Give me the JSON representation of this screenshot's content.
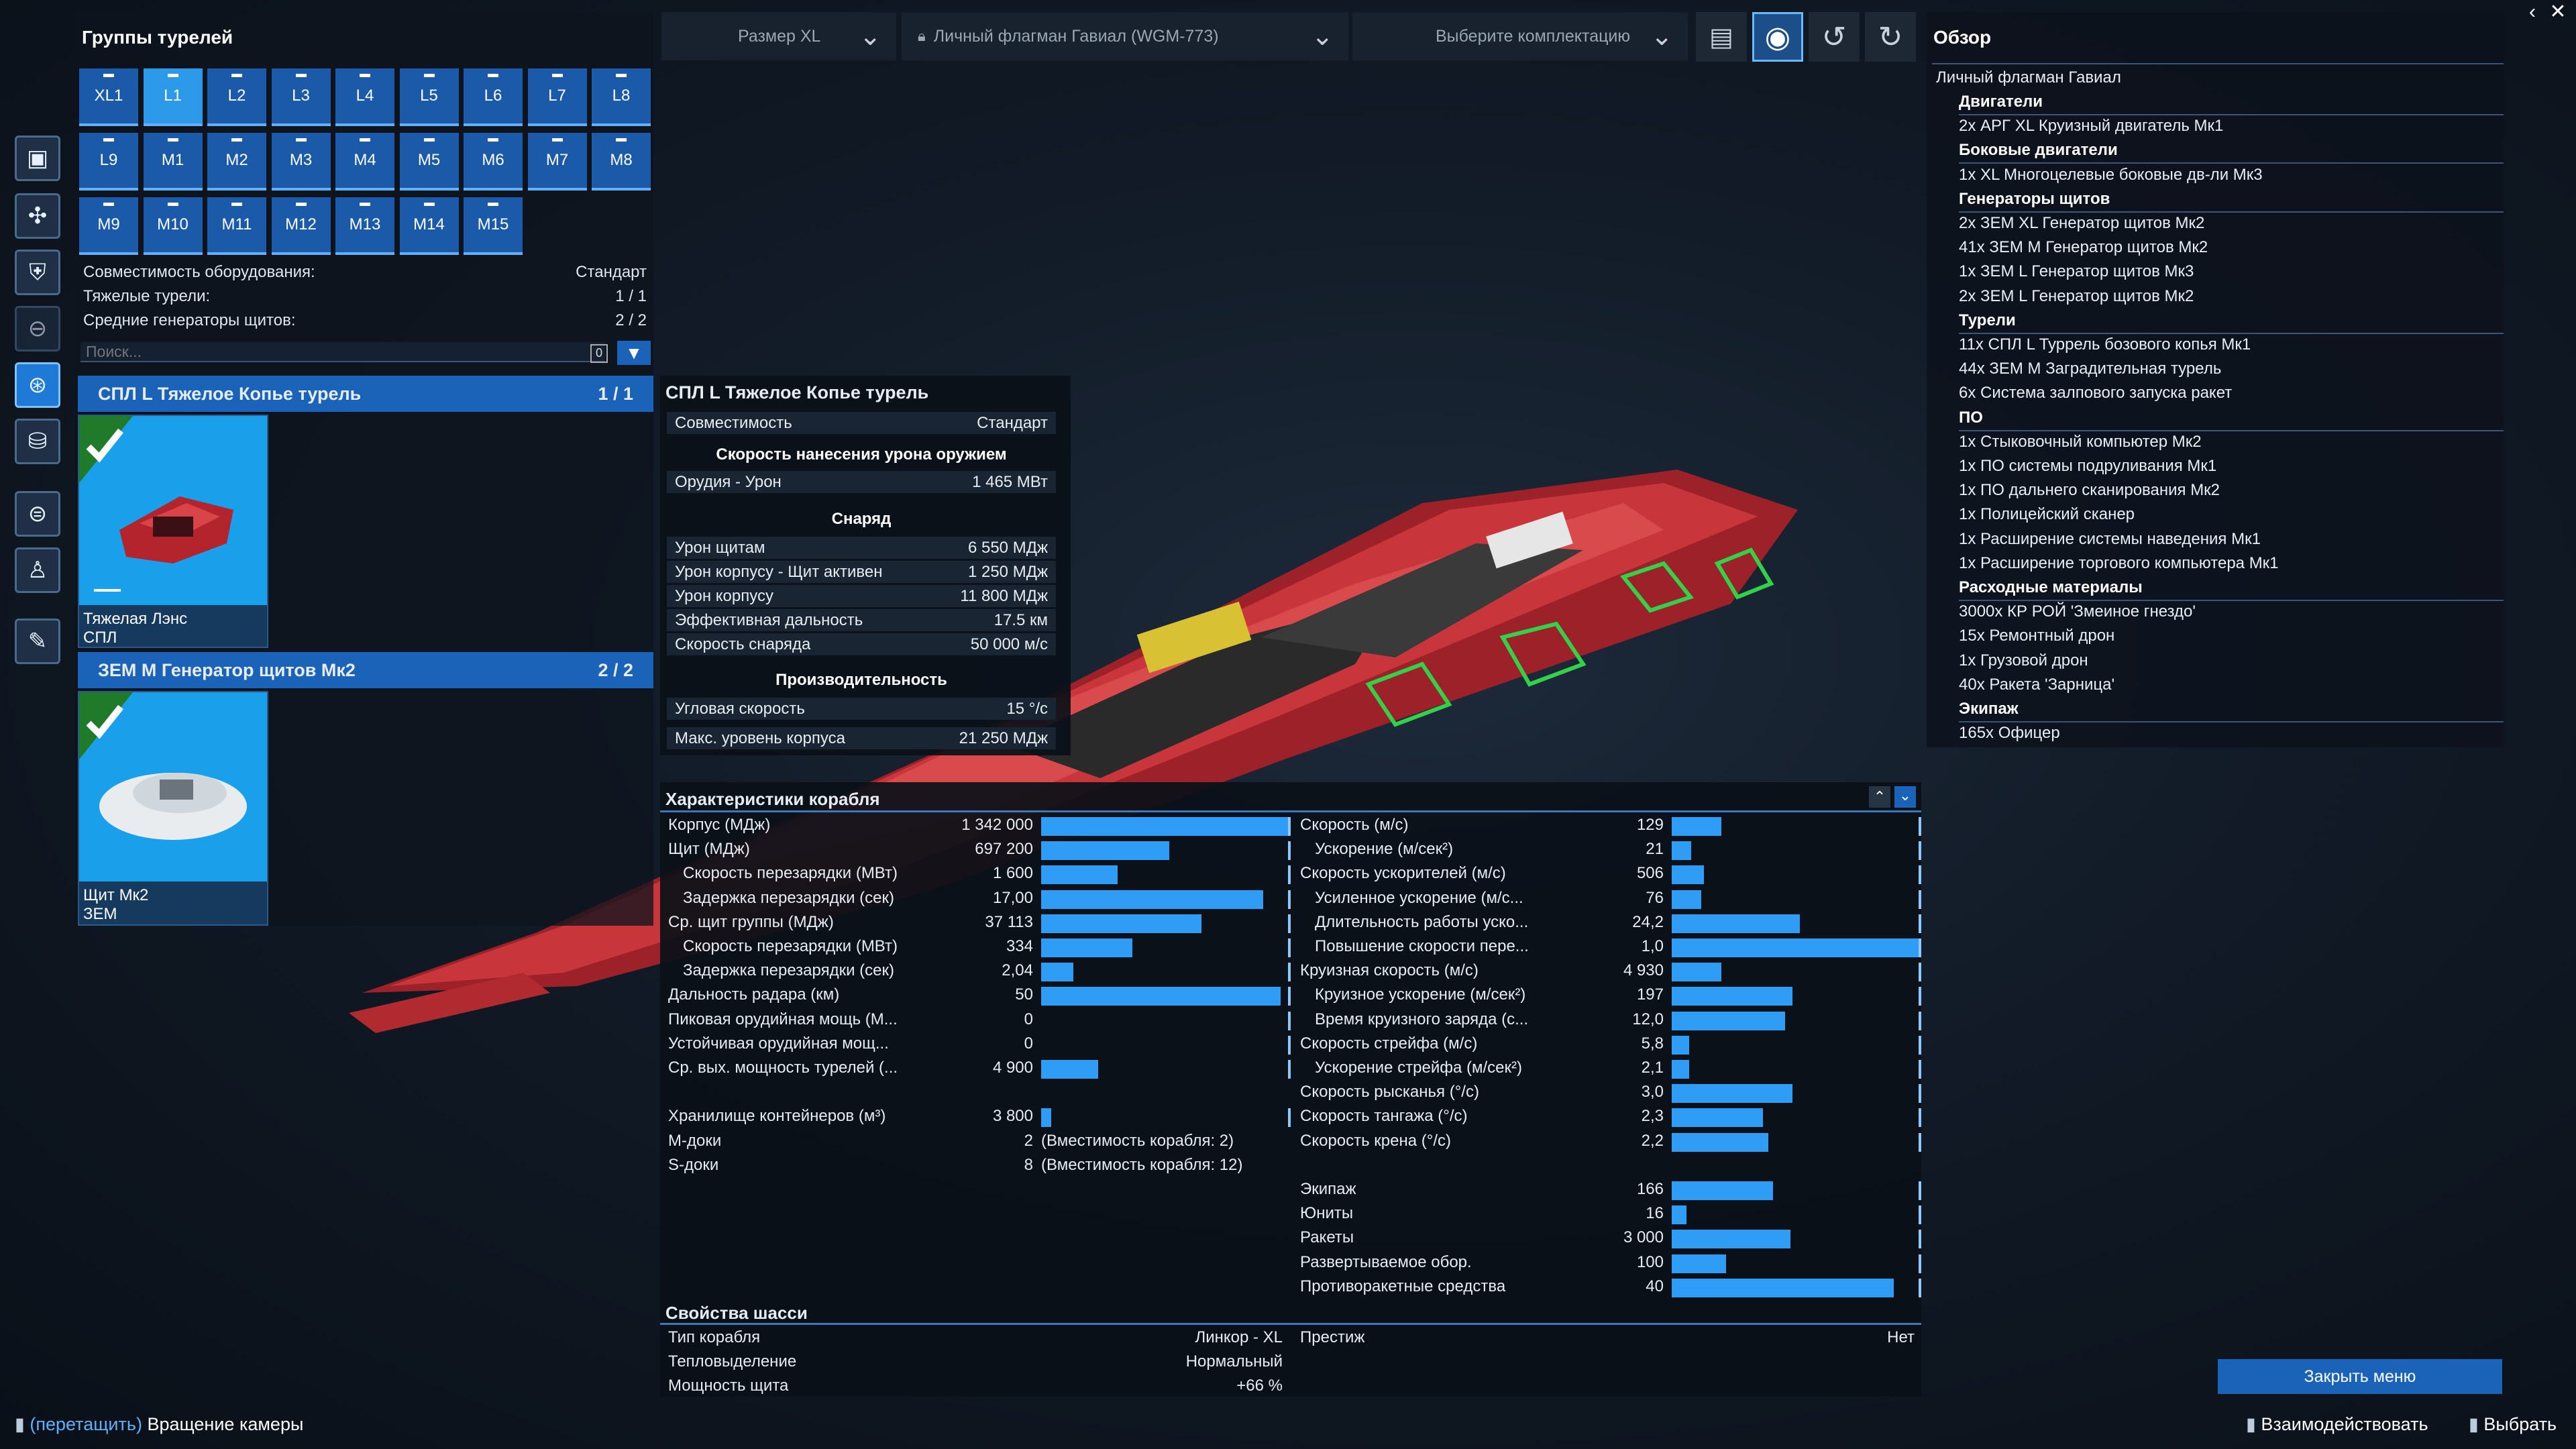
{
  "top": {
    "size": "Размер XL",
    "ship": "Личный флагман Гавиал (WGM-773)",
    "loadout": "Выберите комплектацию"
  },
  "groups": {
    "title": "Группы турелей",
    "rows": [
      [
        "XL1",
        "L1",
        "L2",
        "L3",
        "L4",
        "L5",
        "L6",
        "L7",
        "L8"
      ],
      [
        "L9",
        "M1",
        "M2",
        "M3",
        "M4",
        "M5",
        "M6",
        "M7",
        "M8"
      ],
      [
        "M9",
        "M10",
        "M11",
        "M12",
        "M13",
        "M14",
        "M15"
      ]
    ],
    "info": [
      {
        "label": "Совместимость оборудования:",
        "value": "Стандарт"
      },
      {
        "label": "Тяжелые турели:",
        "value": "1 / 1"
      },
      {
        "label": "Средние генераторы щитов:",
        "value": "2 / 2"
      }
    ],
    "search_placeholder": "Поиск...",
    "search_count": "0",
    "group1": {
      "name": "СПЛ L Тяжелое Копье турель",
      "count": "1 / 1",
      "card_line1": "Тяжелая Лэнс",
      "card_line2": "СПЛ"
    },
    "group2": {
      "name": "ЗЕМ M Генератор щитов Мк2",
      "count": "2 / 2",
      "card_line1": "Щит Мк2",
      "card_line2": "ЗЕМ"
    }
  },
  "tooltip": {
    "title": "СПЛ L Тяжелое Копье турель",
    "compat_label": "Совместимость",
    "compat_value": "Стандарт",
    "sec1": "Скорость нанесения урона оружием",
    "dmg_label": "Орудия - Урон",
    "dmg_value": "1 465 МВт",
    "sec2": "Снаряд",
    "proj": [
      {
        "label": "Урон щитам",
        "value": "6 550 МДж"
      },
      {
        "label": "Урон корпусу - Щит активен",
        "value": "1 250 МДж"
      },
      {
        "label": "Урон корпусу",
        "value": "11 800 МДж"
      },
      {
        "label": "Эффективная дальность",
        "value": "17.5 км"
      },
      {
        "label": "Скорость снаряда",
        "value": "50 000 м/с"
      }
    ],
    "sec3": "Производительность",
    "perf": [
      {
        "label": "Угловая скорость",
        "value": "15 °/с"
      },
      {
        "label": "Макс. уровень корпуса",
        "value": "21 250 МДж"
      }
    ]
  },
  "overview": {
    "title": "Обзор",
    "ship": "Личный флагман Гавиал",
    "lines": [
      {
        "t": "Двигатели",
        "cat": true
      },
      {
        "t": "2x АРГ XL Круизный двигатель Мк1"
      },
      {
        "t": "Боковые двигатели",
        "cat": true
      },
      {
        "t": "1x XL Многоцелевые боковые дв-ли Мк3"
      },
      {
        "t": "Генераторы щитов",
        "cat": true
      },
      {
        "t": "2x ЗЕМ XL Генератор щитов Мк2"
      },
      {
        "t": "41x ЗЕМ M Генератор щитов Мк2"
      },
      {
        "t": "1x ЗЕМ L Генератор щитов Мк3"
      },
      {
        "t": "2x ЗЕМ L Генератор щитов Мк2"
      },
      {
        "t": "Турели",
        "cat": true
      },
      {
        "t": "11x СПЛ L Туррель бозового копья Мк1"
      },
      {
        "t": "44x ЗЕМ M Заградительная турель"
      },
      {
        "t": "6x Система залпового запуска ракет"
      },
      {
        "t": "ПО",
        "cat": true
      },
      {
        "t": "1x Стыковочный компьютер Мк2"
      },
      {
        "t": "1x ПО системы подруливания Мк1"
      },
      {
        "t": "1x ПО дальнего сканирования Мк2"
      },
      {
        "t": "1x Полицейский сканер"
      },
      {
        "t": "1x Расширение системы наведения Мк1"
      },
      {
        "t": "1x Расширение торгового компьютера Мк1"
      },
      {
        "t": "Расходные материалы",
        "cat": true
      },
      {
        "t": "3000x КР РОЙ 'Змеиное гнездо'"
      },
      {
        "t": "15x Ремонтный дрон"
      },
      {
        "t": "1x Грузовой дрон"
      },
      {
        "t": "40x Ракета 'Зарница'"
      },
      {
        "t": "Экипаж",
        "cat": true
      },
      {
        "t": "165x Офицер"
      }
    ],
    "close": "Закрыть меню"
  },
  "stats": {
    "title": "Характеристики корабля",
    "left": [
      {
        "label": "Корпус (МДж)",
        "value": "1 342 000",
        "bar": 1.0,
        "indent": false
      },
      {
        "label": "Щит (МДж)",
        "value": "697 200",
        "bar": 0.52,
        "indent": false
      },
      {
        "label": "Скорость перезарядки (МВт)",
        "value": "1 600",
        "bar": 0.31,
        "indent": true
      },
      {
        "label": "Задержка перезарядки (сек)",
        "value": "17,00",
        "bar": 0.9,
        "indent": true
      },
      {
        "label": "Ср. щит группы (МДж)",
        "value": "37 113",
        "bar": 0.65,
        "indent": false
      },
      {
        "label": "Скорость перезарядки (МВт)",
        "value": "334",
        "bar": 0.37,
        "indent": true
      },
      {
        "label": "Задержка перезарядки (сек)",
        "value": "2,04",
        "bar": 0.13,
        "indent": true
      },
      {
        "label": "Дальность радара (км)",
        "value": "50",
        "bar": 0.97,
        "indent": false
      },
      {
        "label": "Пиковая орудийная мощь (М...",
        "value": "0",
        "bar": 0,
        "indent": false
      },
      {
        "label": "Устойчивая орудийная мощ...",
        "value": "0",
        "bar": 0,
        "indent": false
      },
      {
        "label": "Ср. вых. мощность турелей (...",
        "value": "4 900",
        "bar": 0.23,
        "indent": false
      },
      {
        "label": "",
        "value": "",
        "bar": null,
        "indent": false
      },
      {
        "label": "Хранилище контейнеров (м³)",
        "value": "3 800",
        "bar": 0.04,
        "indent": false
      },
      {
        "label": "M-доки",
        "value": "2",
        "note": "(Вместимость корабля: 2)",
        "bar": null,
        "indent": false
      },
      {
        "label": "S-доки",
        "value": "8",
        "note": "(Вместимость корабля: 12)",
        "bar": null,
        "indent": false
      }
    ],
    "right": [
      {
        "label": "Скорость (м/с)",
        "value": "129",
        "bar": 0.2,
        "indent": false
      },
      {
        "label": "Ускорение (м/сек²)",
        "value": "21",
        "bar": 0.08,
        "indent": true
      },
      {
        "label": "Скорость ускорителей (м/с)",
        "value": "506",
        "bar": 0.13,
        "indent": false
      },
      {
        "label": "Усиленное ускорение (м/с...",
        "value": "76",
        "bar": 0.12,
        "indent": true
      },
      {
        "label": "Длительность работы уско...",
        "value": "24,2",
        "bar": 0.52,
        "indent": true
      },
      {
        "label": "Повышение скорости пере...",
        "value": "1,0",
        "bar": 1.0,
        "indent": true
      },
      {
        "label": "Круизная скорость (м/с)",
        "value": "4 930",
        "bar": 0.2,
        "indent": false
      },
      {
        "label": "Круизное ускорение (м/сек²)",
        "value": "197",
        "bar": 0.49,
        "indent": true
      },
      {
        "label": "Время круизного заряда (с...",
        "value": "12,0",
        "bar": 0.46,
        "indent": true
      },
      {
        "label": "Скорость стрейфа (м/с)",
        "value": "5,8",
        "bar": 0.07,
        "indent": false
      },
      {
        "label": "Ускорение стрейфа (м/сек²)",
        "value": "2,1",
        "bar": 0.07,
        "indent": true
      },
      {
        "label": "Скорость рысканья (°/с)",
        "value": "3,0",
        "bar": 0.49,
        "indent": false
      },
      {
        "label": "Скорость тангажа (°/с)",
        "value": "2,3",
        "bar": 0.37,
        "indent": false
      },
      {
        "label": "Скорость крена (°/с)",
        "value": "2,2",
        "bar": 0.39,
        "indent": false
      },
      {
        "label": "",
        "value": "",
        "bar": null,
        "indent": false
      },
      {
        "label": "Экипаж",
        "value": "166",
        "bar": 0.41,
        "indent": false
      },
      {
        "label": "Юниты",
        "value": "16",
        "bar": 0.06,
        "indent": false
      },
      {
        "label": "Ракеты",
        "value": "3 000",
        "bar": 0.48,
        "indent": false
      },
      {
        "label": "Развертываемое обор.",
        "value": "100",
        "bar": 0.22,
        "indent": false
      },
      {
        "label": "Противоракетные средства",
        "value": "40",
        "bar": 0.9,
        "indent": false
      }
    ],
    "chassis_title": "Свойства шасси",
    "chassis": [
      {
        "label": "Тип корабля",
        "value": "Линкор - XL"
      },
      {
        "label": "Тепловыделение",
        "value": "Нормальный"
      },
      {
        "label": "Мощность щита",
        "value": "+66 %"
      }
    ],
    "prestige_label": "Престиж",
    "prestige_value": "Нет"
  },
  "footer": {
    "drag_key": "(перетащить)",
    "drag_label": "Вращение камеры",
    "interact": "Взаимодействовать",
    "select": "Выбрать"
  },
  "colors": {
    "accent": "#1a63b8",
    "bar": "#2f9cf5",
    "hull": "#c8353a"
  }
}
